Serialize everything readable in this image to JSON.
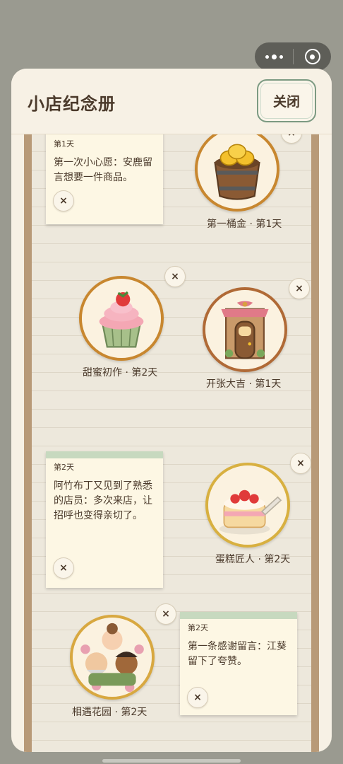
{
  "window": {
    "title": "小店纪念册",
    "close_label": "关闭"
  },
  "capsule": {
    "more_icon": "more-dots-icon",
    "close_icon": "target-icon"
  },
  "notes": [
    {
      "day": "第1天",
      "text": "第一次小心愿：安鹿留言想要一件商品。"
    },
    {
      "day": "第2天",
      "text": "阿竹布丁又见到了熟悉的店员：多次来店，让招呼也变得亲切了。"
    },
    {
      "day": "第2天",
      "text": "第一条感谢留言：江葵留下了夸赞。"
    }
  ],
  "badges": [
    {
      "caption": "第一桶金 · 第1天",
      "icon": "gold-bucket-icon"
    },
    {
      "caption": "甜蜜初作 · 第2天",
      "icon": "cupcake-icon"
    },
    {
      "caption": "开张大吉 · 第1天",
      "icon": "shop-door-icon"
    },
    {
      "caption": "蛋糕匠人 · 第2天",
      "icon": "cake-icon"
    },
    {
      "caption": "相遇花园 · 第2天",
      "icon": "garden-friends-icon"
    }
  ],
  "dismiss_glyph": "×",
  "colors": {
    "accent_green": "#7c9a82",
    "frame_gold": "#c8872f",
    "board_wood": "#b89a78",
    "text_brown": "#4b3a2b"
  }
}
